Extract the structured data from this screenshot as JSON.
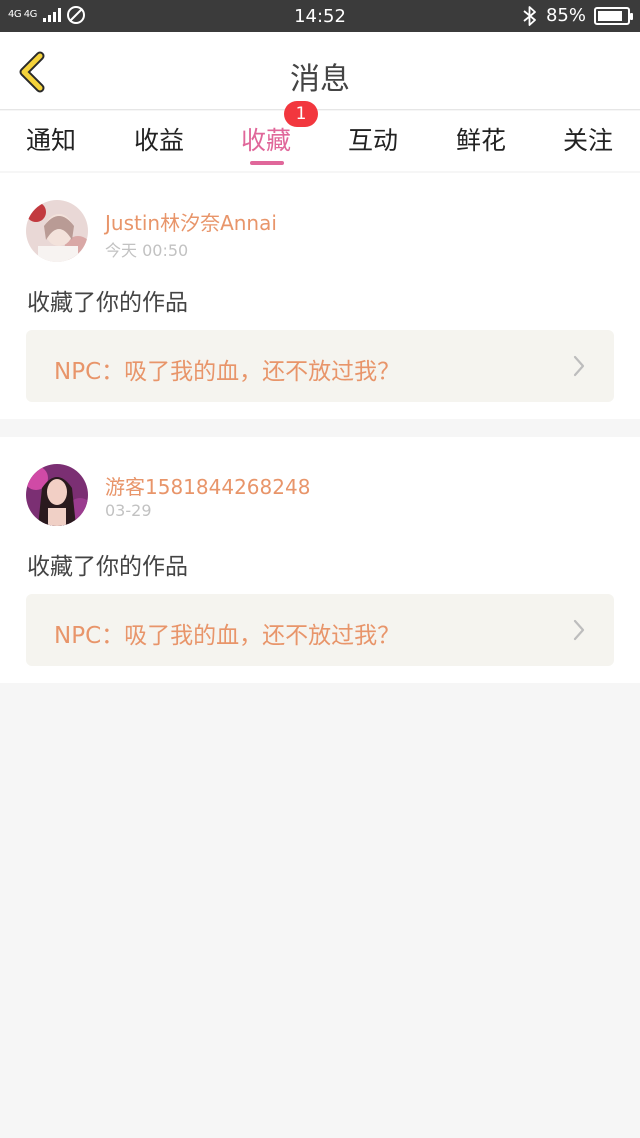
{
  "status_bar": {
    "network": "4G 4G",
    "time": "14:52",
    "battery_percent": "85%",
    "battery_level": 0.85,
    "bluetooth_icon": "bluetooth-icon"
  },
  "header": {
    "title": "消息",
    "back_icon": "chevron-left-icon",
    "back_icon_color": "#f5d33b"
  },
  "tabs": [
    {
      "label": "通知"
    },
    {
      "label": "收益"
    },
    {
      "label": "收藏",
      "active": true,
      "badge": "1"
    },
    {
      "label": "互动"
    },
    {
      "label": "鲜花"
    },
    {
      "label": "关注"
    }
  ],
  "accent_color": "#e0679a",
  "name_color": "#e8956a",
  "badge_color": "#f2373e",
  "messages": [
    {
      "user": "Justin林汐奈Annai",
      "time": "今天 00:50",
      "action": "收藏了你的作品",
      "work_title": "NPC：吸了我的血，还不放过我？"
    },
    {
      "user": "游客1581844268248",
      "time": "03-29",
      "action": "收藏了你的作品",
      "work_title": "NPC：吸了我的血，还不放过我？"
    }
  ]
}
